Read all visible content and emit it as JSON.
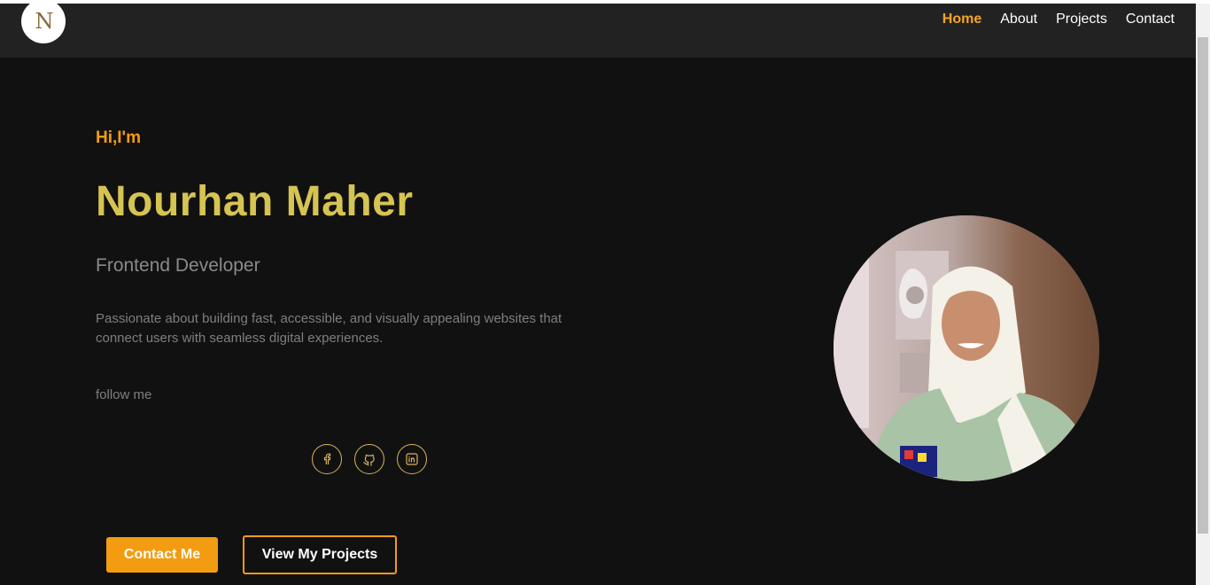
{
  "logo": {
    "letter": "N"
  },
  "nav": {
    "items": [
      {
        "label": "Home",
        "active": true
      },
      {
        "label": "About",
        "active": false
      },
      {
        "label": "Projects",
        "active": false
      },
      {
        "label": "Contact",
        "active": false
      }
    ]
  },
  "hero": {
    "greeting": "Hi,I'm",
    "name": "Nourhan Maher",
    "role": "Frontend Developer",
    "bio": "Passionate about building fast, accessible, and visually appealing websites that connect users with seamless digital experiences.",
    "follow_label": "follow me"
  },
  "socials": [
    {
      "icon": "facebook-icon"
    },
    {
      "icon": "github-icon"
    },
    {
      "icon": "linkedin-icon"
    }
  ],
  "buttons": {
    "contact": "Contact Me",
    "projects": "View My Projects"
  },
  "colors": {
    "accent": "#f39c12",
    "name": "#d6c452",
    "background": "#121112",
    "navbar": "#232223"
  }
}
